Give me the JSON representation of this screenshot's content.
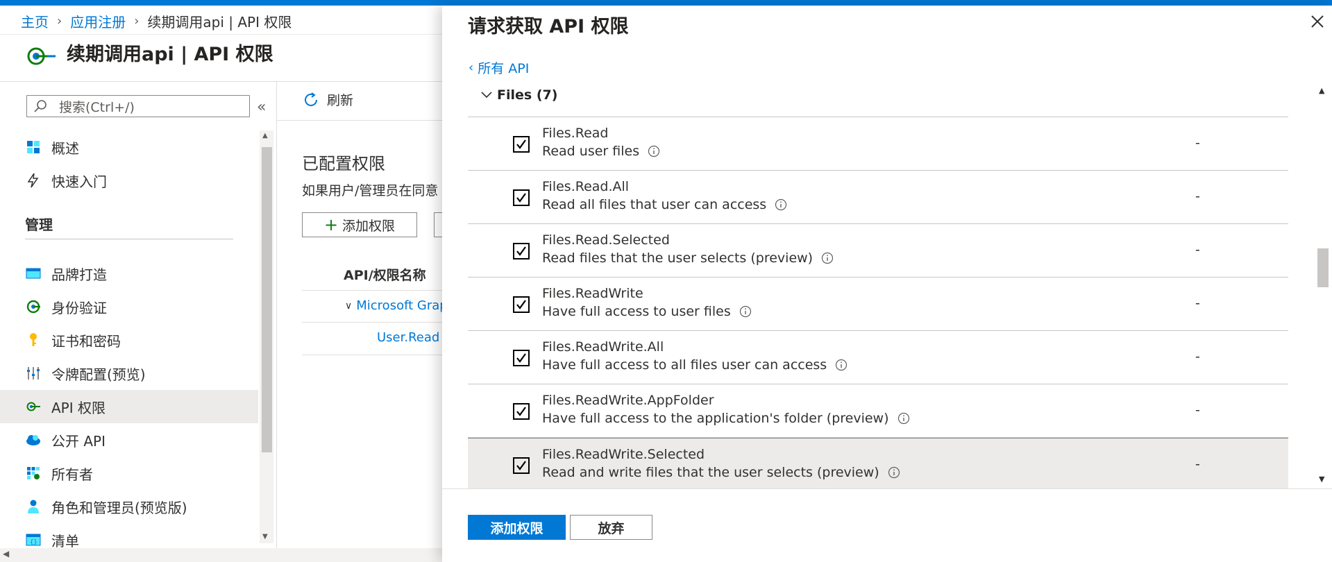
{
  "colors": {
    "accent": "#0078d4",
    "selected_row": "#edebe9",
    "text": "#323130"
  },
  "breadcrumb": {
    "home": "主页",
    "app_reg": "应用注册",
    "current": "续期调用api | API 权限"
  },
  "page": {
    "title": "续期调用api | API 权限"
  },
  "sidebar": {
    "search_placeholder": "搜索(Ctrl+/)",
    "collapse_icon": "double-chevron-left-icon",
    "top_items": [
      {
        "label": "概述",
        "icon": "overview-grid-icon"
      },
      {
        "label": "快速入门",
        "icon": "lightning-icon"
      }
    ],
    "section_label": "管理",
    "manage_items": [
      {
        "label": "品牌打造",
        "icon": "branding-card-icon"
      },
      {
        "label": "身份验证",
        "icon": "auth-arrow-icon"
      },
      {
        "label": "证书和密码",
        "icon": "key-icon"
      },
      {
        "label": "令牌配置(预览)",
        "icon": "token-sliders-icon"
      },
      {
        "label": "API 权限",
        "icon": "api-permission-icon",
        "active": true
      },
      {
        "label": "公开 API",
        "icon": "cloud-api-icon"
      },
      {
        "label": "所有者",
        "icon": "owners-grid-icon"
      },
      {
        "label": "角色和管理员(预览版)",
        "icon": "roles-person-icon"
      },
      {
        "label": "清单",
        "icon": "manifest-icon"
      }
    ]
  },
  "main": {
    "refresh_label": "刷新",
    "configured_title": "已配置权限",
    "configured_desc": "如果用户/管理员在同意",
    "add_permission_label": "添加权限",
    "column_api_name": "API/权限名称",
    "group_microsoft_graph": "Microsoft Grap",
    "permission_user_read": "User.Read"
  },
  "panel": {
    "title": "请求获取 API 权限",
    "back_link": "所有 API",
    "group": {
      "label": "Files (7)",
      "expanded": true
    },
    "permissions": [
      {
        "name": "Files.Read",
        "description": "Read user files",
        "checked": true,
        "admin_consent": "-"
      },
      {
        "name": "Files.Read.All",
        "description": "Read all files that user can access",
        "checked": true,
        "admin_consent": "-"
      },
      {
        "name": "Files.Read.Selected",
        "description": "Read files that the user selects (preview)",
        "checked": true,
        "admin_consent": "-"
      },
      {
        "name": "Files.ReadWrite",
        "description": "Have full access to user files",
        "checked": true,
        "admin_consent": "-"
      },
      {
        "name": "Files.ReadWrite.All",
        "description": "Have full access to all files user can access",
        "checked": true,
        "admin_consent": "-"
      },
      {
        "name": "Files.ReadWrite.AppFolder",
        "description": "Have full access to the application's folder (preview)",
        "checked": true,
        "admin_consent": "-"
      },
      {
        "name": "Files.ReadWrite.Selected",
        "description": "Read and write files that the user selects (preview)",
        "checked": true,
        "admin_consent": "-",
        "selected": true
      }
    ],
    "footer": {
      "primary_label": "添加权限",
      "secondary_label": "放弃"
    }
  }
}
